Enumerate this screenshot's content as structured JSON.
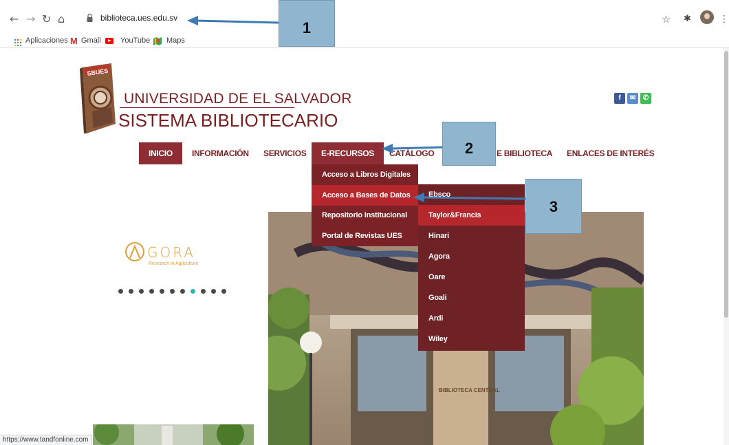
{
  "browser": {
    "url": "biblioteca.ues.edu.sv",
    "bookmarks": [
      "Aplicaciones",
      "Gmail",
      "YouTube",
      "Maps"
    ]
  },
  "site": {
    "university": "UNIVERSIDAD DE EL SALVADOR",
    "system": "SISTEMA BIBLIOTECARIO",
    "logo_text": "SBUES",
    "social": [
      "facebook-icon",
      "mail-icon",
      "phone-icon"
    ]
  },
  "nav": {
    "items": [
      "INICIO",
      "INFORMACIÓN",
      "SERVICIOS",
      "E-RECURSOS",
      "CATÁLOGO",
      "E BIBLIOTECA",
      "ENLACES DE INTERÉS"
    ]
  },
  "dropdown": {
    "items": [
      "Acceso a Libros Digitales",
      "Acceso a Bases de Datos",
      "Repositorio Institucional",
      "Portal de Revistas UES"
    ]
  },
  "submenu": {
    "items": [
      "Ebsco",
      "Taylor&Francis",
      "Hinari",
      "Agora",
      "Oare",
      "Goali",
      "Ardi",
      "Wiley"
    ]
  },
  "carousel": {
    "logo_text": "GORA",
    "tagline": "Research in Agriculture",
    "dot_count": 11,
    "active_index": 7
  },
  "photo": {
    "sign": "BIBLIOTECA CENTRAL"
  },
  "status_url": "https://www.tandfonline.com",
  "callouts": [
    "1",
    "2",
    "3"
  ],
  "colors": {
    "brand": "#7a1f22",
    "menu": "#8e2d33",
    "callout": "#8fb5cf",
    "arrow": "#3d7ab3",
    "highlight": "#b6272d"
  }
}
